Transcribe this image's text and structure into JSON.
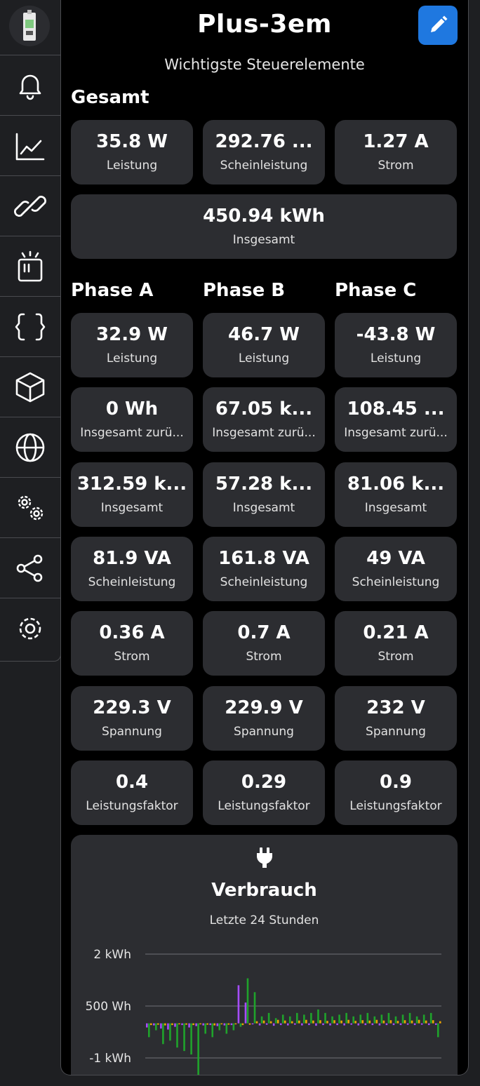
{
  "app": {
    "title": "Plus-3em",
    "subtitle": "Wichtigste Steuerelemente",
    "edit_icon": "pencil-icon",
    "device_icon": "device-meter-icon"
  },
  "sidebar": {
    "items": [
      {
        "name": "bell-icon"
      },
      {
        "name": "chart-line-icon"
      },
      {
        "name": "link-icon"
      },
      {
        "name": "device-icon"
      },
      {
        "name": "braces-icon"
      },
      {
        "name": "cube-icon"
      },
      {
        "name": "globe-icon"
      },
      {
        "name": "cogs-icon"
      },
      {
        "name": "share-icon"
      },
      {
        "name": "gear-icon"
      }
    ]
  },
  "gesamt": {
    "heading": "Gesamt",
    "tiles": [
      {
        "value": "35.8 W",
        "label": "Leistung"
      },
      {
        "value": "292.76 ...",
        "label": "Scheinleistung"
      },
      {
        "value": "1.27 A",
        "label": "Strom"
      },
      {
        "value": "450.94 kWh",
        "label": "Insgesamt"
      }
    ]
  },
  "phases": {
    "headings": [
      "Phase A",
      "Phase B",
      "Phase C"
    ],
    "rows": [
      [
        {
          "value": "32.9 W",
          "label": "Leistung"
        },
        {
          "value": "46.7 W",
          "label": "Leistung"
        },
        {
          "value": "-43.8 W",
          "label": "Leistung"
        }
      ],
      [
        {
          "value": "0 Wh",
          "label": "Insgesamt zurü..."
        },
        {
          "value": "67.05 k...",
          "label": "Insgesamt zurü..."
        },
        {
          "value": "108.45 ...",
          "label": "Insgesamt zurü..."
        }
      ],
      [
        {
          "value": "312.59 k...",
          "label": "Insgesamt"
        },
        {
          "value": "57.28 k...",
          "label": "Insgesamt"
        },
        {
          "value": "81.06 k...",
          "label": "Insgesamt"
        }
      ],
      [
        {
          "value": "81.9 VA",
          "label": "Scheinleistung"
        },
        {
          "value": "161.8 VA",
          "label": "Scheinleistung"
        },
        {
          "value": "49 VA",
          "label": "Scheinleistung"
        }
      ],
      [
        {
          "value": "0.36 A",
          "label": "Strom"
        },
        {
          "value": "0.7 A",
          "label": "Strom"
        },
        {
          "value": "0.21 A",
          "label": "Strom"
        }
      ],
      [
        {
          "value": "229.3 V",
          "label": "Spannung"
        },
        {
          "value": "229.9 V",
          "label": "Spannung"
        },
        {
          "value": "232 V",
          "label": "Spannung"
        }
      ],
      [
        {
          "value": "0.4",
          "label": "Leistungsfaktor"
        },
        {
          "value": "0.29",
          "label": "Leistungsfaktor"
        },
        {
          "value": "0.9",
          "label": "Leistungsfaktor"
        }
      ]
    ]
  },
  "chart_card": {
    "icon": "plug-icon",
    "title": "Verbrauch",
    "subtitle": "Letzte 24 Stunden"
  },
  "chart_data": {
    "type": "bar",
    "title": "Verbrauch",
    "subtitle": "Letzte 24 Stunden",
    "ytick_labels": [
      "2 kWh",
      "500 Wh",
      "-1 kWh"
    ],
    "ylim": [
      -1000,
      2000
    ],
    "colors": {
      "purple": "#a64dff",
      "green": "#1fa32b",
      "orange": "#f0a500",
      "gray": "#c8c8c8"
    },
    "series": [
      {
        "color": "purple",
        "values": [
          -120,
          -60,
          -150,
          -180,
          -100,
          -50,
          -120,
          -80,
          -60,
          -50,
          -80,
          -60,
          -50,
          1100,
          600,
          -30,
          -60,
          -40,
          -70,
          -50,
          -60,
          -40,
          -60,
          -50,
          -70,
          -50,
          -60,
          -50,
          -60,
          -40,
          -60,
          -50,
          -50,
          -60,
          -50,
          -50,
          -50,
          -40,
          -50,
          -40,
          -50,
          -45
        ]
      },
      {
        "color": "green",
        "values": [
          -400,
          -200,
          -600,
          -500,
          -700,
          -800,
          -900,
          -1600,
          -300,
          -400,
          -200,
          -300,
          -200,
          -100,
          1300,
          900,
          200,
          300,
          150,
          250,
          200,
          300,
          250,
          300,
          400,
          300,
          200,
          250,
          300,
          200,
          250,
          300,
          200,
          250,
          300,
          200,
          250,
          300,
          200,
          250,
          300,
          -400
        ]
      },
      {
        "color": "orange",
        "values": [
          -50,
          -40,
          -60,
          -50,
          -30,
          -40,
          -50,
          -30,
          -40,
          -60,
          -30,
          -40,
          -30,
          -50,
          -40,
          60,
          80,
          60,
          100,
          80,
          60,
          80,
          100,
          80,
          90,
          70,
          90,
          80,
          100,
          70,
          90,
          80,
          100,
          80,
          90,
          70,
          90,
          80,
          100,
          80,
          90,
          60
        ]
      }
    ]
  }
}
